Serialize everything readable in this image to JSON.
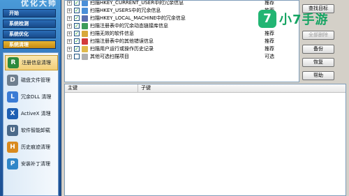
{
  "brand": "优化大师",
  "nav": [
    "开始",
    "系统检测",
    "系统优化",
    "系统清理"
  ],
  "tools": [
    {
      "label": "注册信息清理",
      "icon": "registry-icon",
      "active": true
    },
    {
      "label": "磁盘文件管理",
      "icon": "disk-icon",
      "active": false
    },
    {
      "label": "冗余DLL 清理",
      "icon": "dll-icon",
      "active": false
    },
    {
      "label": "ActiveX 清理",
      "icon": "activex-icon",
      "active": false
    },
    {
      "label": "软件智能卸载",
      "icon": "uninstall-icon",
      "active": false
    },
    {
      "label": "历史痕迹清理",
      "icon": "history-icon",
      "active": false
    },
    {
      "label": "安装补丁清理",
      "icon": "patch-icon",
      "active": false
    }
  ],
  "rows": [
    {
      "text": "扫描HKEY_CURRENT_USER中的冗余信息",
      "status": "推荐",
      "checked": true
    },
    {
      "text": "扫描HKEY_USERS中的冗余信息",
      "status": "推荐",
      "checked": true
    },
    {
      "text": "扫描HKEY_LOCAL_MACHINE中的冗余信息",
      "status": "推荐",
      "checked": true
    },
    {
      "text": "扫描注册表中的冗余动态链接库信息",
      "status": "推荐",
      "checked": true
    },
    {
      "text": "扫描无效的软件信息",
      "status": "推荐",
      "checked": true
    },
    {
      "text": "扫描注册表中的其他错误信息",
      "status": "推荐",
      "checked": true
    },
    {
      "text": "扫描用户运行或操作历史记录",
      "status": "推荐",
      "checked": true
    },
    {
      "text": "其他可选扫描项目",
      "status": "可选",
      "checked": false
    }
  ],
  "buttons": {
    "scan": "查找目标",
    "delete_all": "全部删除",
    "backup": "备份",
    "restore": "恢复",
    "help": "帮助"
  },
  "table": {
    "col_main": "主键",
    "col_sub": "子键"
  },
  "watermark": {
    "logo": "7",
    "text": "小7手游"
  },
  "colors": {
    "accent": "#2e6fb8",
    "active": "#f2cf78",
    "watermark": "#16a463"
  }
}
